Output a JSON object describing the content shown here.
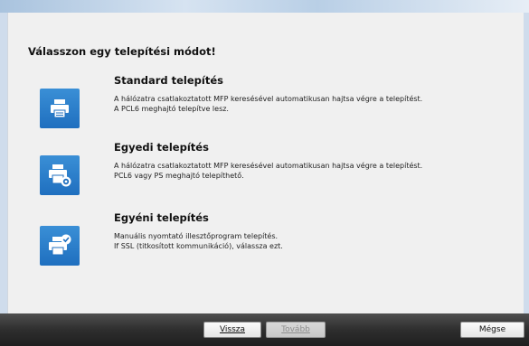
{
  "header": {
    "title": "Válasszon egy telepítési módot!"
  },
  "options": [
    {
      "title": "Standard telepítés",
      "desc": [
        "A hálózatra csatlakoztatott MFP keresésével automatikusan hajtsa végre a telepítést.",
        "A PCL6 meghajtó telepítve lesz."
      ],
      "icon": "printer-icon"
    },
    {
      "title": "Egyedi telepítés",
      "desc": [
        "A hálózatra csatlakoztatott MFP keresésével automatikusan hajtsa végre a telepítést.",
        "PCL6 vagy PS meghajtó telepíthető."
      ],
      "icon": "printer-gear-icon"
    },
    {
      "title": "Egyéni telepítés",
      "desc": [
        "Manuális nyomtató illesztőprogram telepítés.",
        "If SSL (titkosított kommunikáció), válassza ezt."
      ],
      "icon": "printer-check-icon"
    }
  ],
  "footer": {
    "back_label": "Vissza",
    "next_label": "Tovább",
    "cancel_label": "Mégse"
  },
  "colors": {
    "tile_blue": "#1f6fbf",
    "panel_bg": "#f0f0f0",
    "bar_dark": "#2e2e2e"
  }
}
